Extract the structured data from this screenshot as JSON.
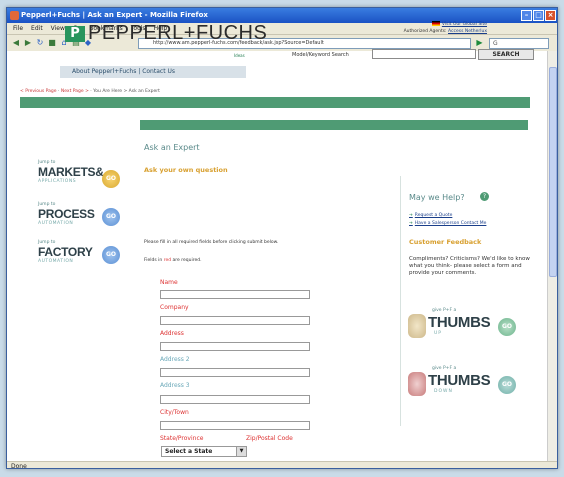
{
  "window": {
    "title": "Pepperl+Fuchs | Ask an Expert - Mozilla Firefox",
    "menu": [
      "File",
      "Edit",
      "View",
      "Go",
      "Bookmarks",
      "Tools",
      "Help"
    ],
    "url": "http://www.am.pepperl-fuchs.com/feedback/ask.jsp?Source=Default",
    "status": "Done"
  },
  "header": {
    "logo_mark": "P",
    "logo": "PEPPERL+FUCHS",
    "tagline": "Ideas",
    "global_site": "Visit Our Global Site",
    "authorized_agents_prefix": "Authorized Agents:",
    "authorized_agents_link": "Access Netherlux",
    "keyword_label": "Model/Keyword Search",
    "search_button": "SEARCH",
    "about_bar": "About Pepperl+Fuchs | Contact Us"
  },
  "breadcrumb": {
    "prev": "< Previous Page",
    "next": "Next Page >",
    "here": "You Are Here > Ask an Expert"
  },
  "sidebar": [
    {
      "jump": "Jump to",
      "title": "MARKETS&",
      "sub": "APPLICATIONS",
      "go": "GO"
    },
    {
      "jump": "Jump to",
      "title": "PROCESS",
      "sub": "AUTOMATION",
      "go": "GO"
    },
    {
      "jump": "Jump to",
      "title": "FACTORY",
      "sub": "AUTOMATION",
      "go": "GO"
    }
  ],
  "main": {
    "title": "Ask an Expert",
    "subtitle": "Ask your own question",
    "instructions": "Please fill in all required fields before clicking submit below.",
    "required_prefix": "Fields in",
    "required_word": "red",
    "required_suffix": "are required.",
    "fields": {
      "name": "Name",
      "company": "Company",
      "address": "Address",
      "address2": "Address 2",
      "address3": "Address 3",
      "city": "City/Town",
      "state": "State/Province",
      "zip": "Zip/Postal Code"
    },
    "state_select_value": "Select a State"
  },
  "help": {
    "title": "May we Help?",
    "icon_glyph": "?",
    "links": [
      "Request a Quote",
      "Have a Salesperson Contact Me"
    ],
    "feedback_title": "Customer Feedback",
    "feedback_text": "Compliments? Criticisms? We'd like to know what you think- please select a form and provide your comments.",
    "thumbs_up": {
      "give": "give P+F a",
      "word": "THUMBS",
      "sub": "UP",
      "go": "GO"
    },
    "thumbs_down": {
      "give": "give P+F a",
      "word": "THUMBS",
      "sub": "DOWN",
      "go": "GO"
    }
  }
}
